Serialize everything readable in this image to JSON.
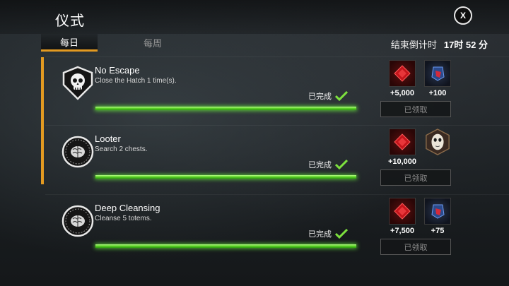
{
  "header": {
    "title": "仪式",
    "close_label": "X"
  },
  "tabs": [
    {
      "label": "每日",
      "active": true
    },
    {
      "label": "每周",
      "active": false
    }
  ],
  "countdown": {
    "label": "结束倒计时",
    "value": "17时 52 分"
  },
  "quests": [
    {
      "name": "No Escape",
      "description": "Close the Hatch 1 time(s).",
      "icon": "skull-icon",
      "status": "已完成",
      "progress": 1.0,
      "rewards": [
        {
          "type": "bloodpoints",
          "icon": "bloodpoints-icon",
          "amount": "+5,000"
        },
        {
          "type": "rift-fragments",
          "icon": "rift-fragment-icon",
          "amount": "+100"
        }
      ],
      "claim_label": "已领取"
    },
    {
      "name": "Looter",
      "description": "Search 2 chests.",
      "icon": "brain-icon",
      "status": "已完成",
      "progress": 1.0,
      "rewards": [
        {
          "type": "bloodpoints",
          "icon": "bloodpoints-icon",
          "amount": "+10,000"
        },
        {
          "type": "killer-mask",
          "icon": "mask-icon",
          "amount": ""
        }
      ],
      "claim_label": "已领取"
    },
    {
      "name": "Deep Cleansing",
      "description": "Cleanse 5 totems.",
      "icon": "brain-icon",
      "status": "已完成",
      "progress": 1.0,
      "rewards": [
        {
          "type": "bloodpoints",
          "icon": "bloodpoints-icon",
          "amount": "+7,500"
        },
        {
          "type": "rift-fragments",
          "icon": "rift-fragment-icon",
          "amount": "+75"
        }
      ],
      "claim_label": "已领取"
    }
  ],
  "colors": {
    "accent": "#e39a21",
    "progress": "#5cd226",
    "bloodpoints": "#c4151b",
    "rift": "#4d7bd8"
  }
}
